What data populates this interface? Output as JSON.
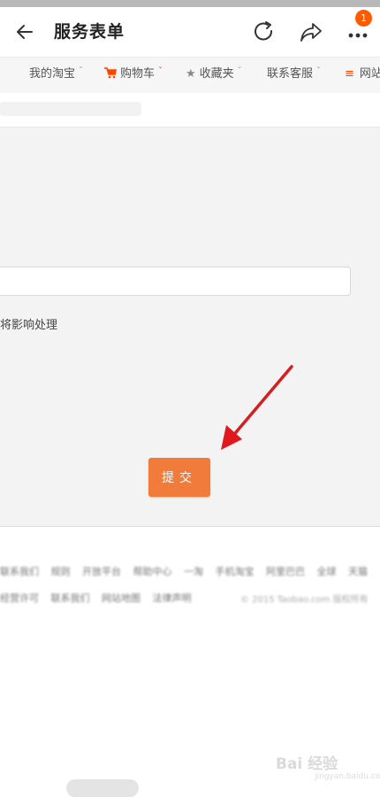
{
  "header": {
    "title": "服务表单",
    "badge_count": "1"
  },
  "nav": {
    "items": [
      {
        "label": "我的淘宝"
      },
      {
        "label": "购物车"
      },
      {
        "label": "收藏夹"
      },
      {
        "label": "联系客服"
      },
      {
        "label": "网站"
      }
    ]
  },
  "form": {
    "note": "将影响处理",
    "submit_label": "提交"
  },
  "footer": {
    "row1": [
      "联系我们",
      "规则",
      "开放平台",
      "帮助中心",
      "一淘",
      "手机淘宝",
      "阿里巴巴",
      "全球",
      "天猫"
    ],
    "row2": [
      "经营许可",
      "联系我们",
      "网站地图",
      "法律声明"
    ],
    "copyright": "© 2015 Taobao.com 版权所有"
  },
  "watermark": {
    "text": "Bai 经验",
    "sub": "jingyan.baidu.com"
  },
  "colors": {
    "accent": "#f07b3a",
    "badge": "#ff5a00",
    "arrow": "#e0191f"
  }
}
